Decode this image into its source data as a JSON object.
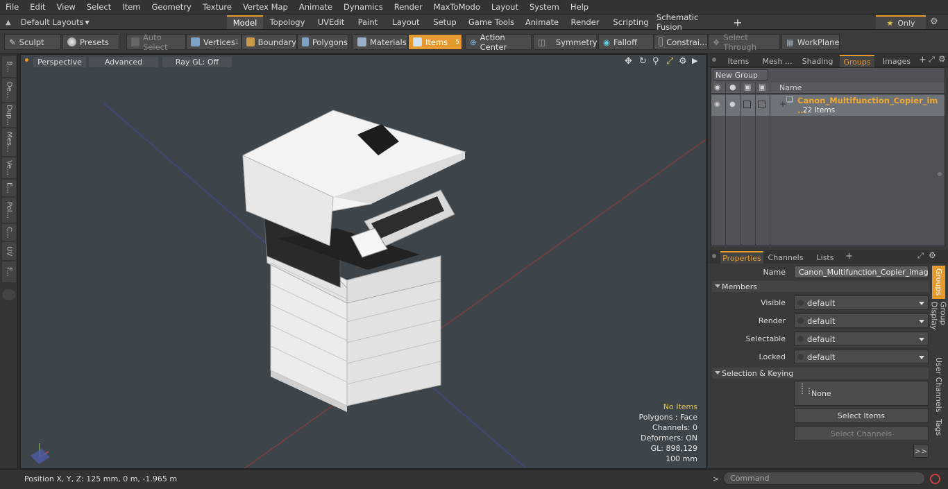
{
  "menu": [
    "File",
    "Edit",
    "View",
    "Select",
    "Item",
    "Geometry",
    "Texture",
    "Vertex Map",
    "Animate",
    "Dynamics",
    "Render",
    "MaxToModo",
    "Layout",
    "System",
    "Help"
  ],
  "layouts": {
    "label": "Default Layouts"
  },
  "tabs": [
    "Model",
    "Topology",
    "UVEdit",
    "Paint",
    "Layout",
    "Setup",
    "Game Tools",
    "Animate",
    "Render",
    "Scripting",
    "Schematic Fusion"
  ],
  "only": "Only",
  "toolbar": {
    "sculpt": "Sculpt",
    "presets": "Presets",
    "auto_select": "Auto Select",
    "vertices": "Vertices",
    "vertices_count": "1",
    "boundary": "Boundary",
    "polygons": "Polygons",
    "materials": "Materials",
    "items": "Items",
    "items_count": "5",
    "action_center": "Action Center",
    "symmetry": "Symmetry",
    "falloff": "Falloff",
    "constraints": "Constrai...",
    "select_through": "Select Through",
    "workplane": "WorkPlane"
  },
  "left_tabs": [
    "B...",
    "De...",
    "Dup...",
    "Mes...",
    "Ve...",
    "E...",
    "Pol...",
    "C...",
    "UV",
    "F..."
  ],
  "viewport": {
    "perspective": "Perspective",
    "advanced": "Advanced",
    "raygl": "Ray GL: Off",
    "stats": {
      "no_items": "No Items",
      "polygons": "Polygons : Face",
      "channels": "Channels: 0",
      "deformers": "Deformers: ON",
      "gl": "GL: 898,129",
      "scale": "100 mm"
    }
  },
  "panel_tabs": [
    "Items",
    "Mesh ...",
    "Shading",
    "Groups",
    "Images"
  ],
  "groups": {
    "new_group": "New Group",
    "col_name": "Name",
    "item_name": "Canon_Multifunction_Copier_im ...",
    "item_count": "22 Items"
  },
  "prop_tabs": [
    "Properties",
    "Channels",
    "Lists"
  ],
  "properties": {
    "name_label": "Name",
    "name_value": "Canon_Multifunction_Copier_image_R",
    "members": "Members",
    "visible_label": "Visible",
    "visible": "default",
    "render_label": "Render",
    "render": "default",
    "selectable_label": "Selectable",
    "selectable": "default",
    "locked_label": "Locked",
    "locked": "default",
    "sel_keying": "Selection & Keying",
    "none": "None",
    "select_items": "Select Items",
    "select_channels": "Select Channels",
    "more": ">>"
  },
  "side_tabs": [
    "Groups",
    "Group Display",
    "User Channels",
    "Tags"
  ],
  "status": {
    "position": "Position X, Y, Z:   125 mm, 0 m, -1.965 m",
    "command": "Command"
  },
  "colors": {
    "accent": "#e59a2f",
    "viewport_bg": "#3d454b"
  }
}
